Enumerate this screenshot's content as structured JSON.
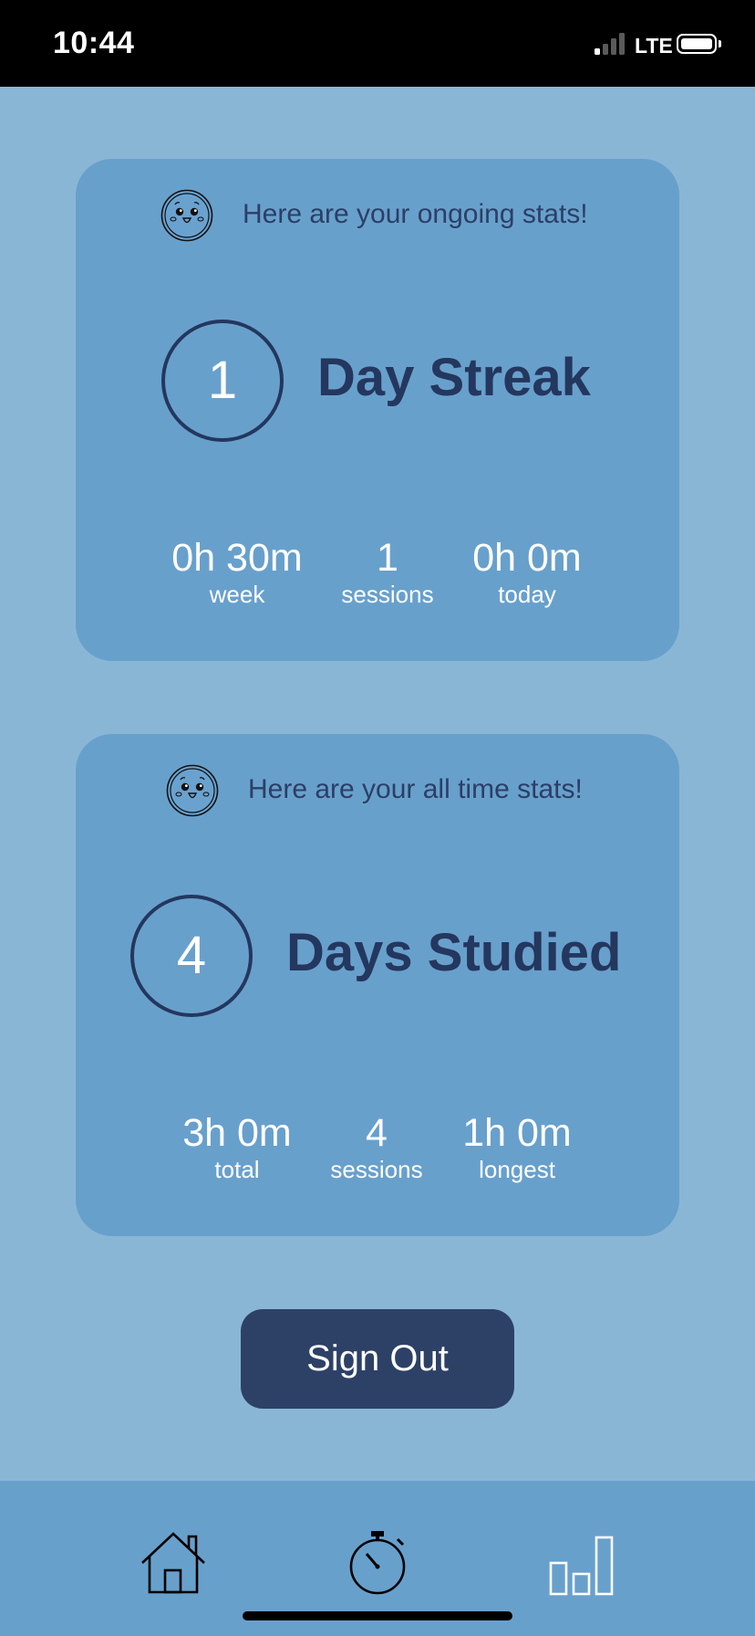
{
  "status_bar": {
    "time": "10:44",
    "network": "LTE"
  },
  "streak_card": {
    "header": "Here are your ongoing stats!",
    "count": "1",
    "label": "Day Streak",
    "stats": [
      {
        "value": "0h 30m",
        "label": "week"
      },
      {
        "value": "1",
        "label": "sessions"
      },
      {
        "value": "0h 0m",
        "label": "today"
      }
    ]
  },
  "alltime_card": {
    "header": "Here are your all time stats!",
    "count": "4",
    "label": "Days Studied",
    "stats": [
      {
        "value": "3h 0m",
        "label": "total"
      },
      {
        "value": "4",
        "label": "sessions"
      },
      {
        "value": "1h 0m",
        "label": "longest"
      }
    ]
  },
  "signout_label": "Sign Out",
  "tab_bar": {
    "icons": [
      "home-icon",
      "stopwatch-icon",
      "bar-chart-icon"
    ]
  },
  "colors": {
    "background": "#8ab6d6",
    "card": "#68a0cc",
    "dark_navy": "#24375e",
    "button": "#2d4167"
  }
}
